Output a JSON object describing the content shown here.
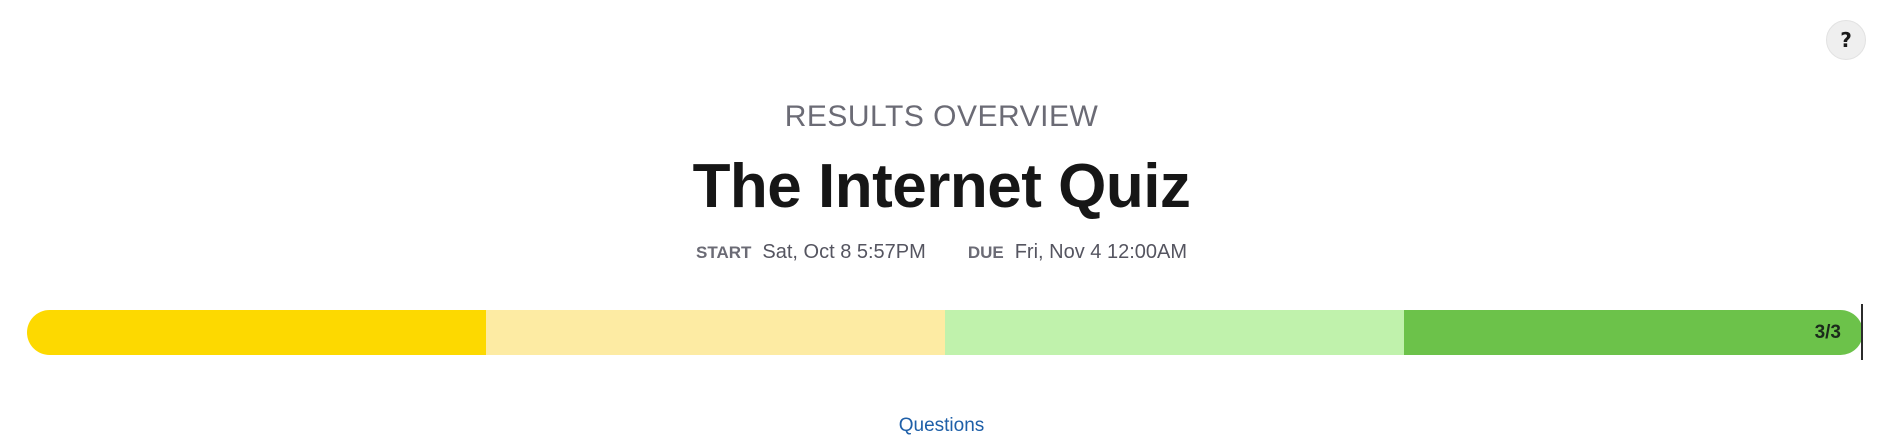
{
  "help": {
    "label": "?"
  },
  "header": {
    "eyebrow": "RESULTS OVERVIEW",
    "title": "The Internet Quiz"
  },
  "dates": {
    "start_label": "START",
    "start_value": "Sat, Oct 8 5:57PM",
    "due_label": "DUE",
    "due_value": "Fri, Nov 4 12:00AM"
  },
  "progress": {
    "label": "3/3",
    "completed": 3,
    "total": 3,
    "segments": [
      {
        "color": "#FDD900"
      },
      {
        "color": "#FDEBA3"
      },
      {
        "color": "#C0F2AC"
      },
      {
        "color": "#6CC24A"
      }
    ]
  },
  "nav": {
    "questions_label": "Questions"
  }
}
